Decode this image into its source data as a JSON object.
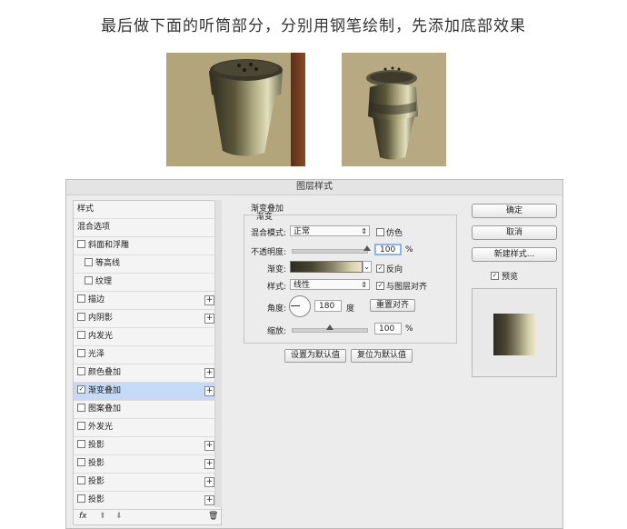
{
  "heading": "最后做下面的听筒部分，分别用钢笔绘制，先添加底部效果",
  "dialog": {
    "title": "图层样式",
    "left_panel": {
      "items": [
        {
          "label": "样式",
          "type": "header"
        },
        {
          "label": "混合选项",
          "type": "header"
        },
        {
          "label": "斜面和浮雕",
          "type": "check",
          "checked": false
        },
        {
          "label": "等高线",
          "type": "check-sub",
          "checked": false
        },
        {
          "label": "纹理",
          "type": "check-sub",
          "checked": false
        },
        {
          "label": "描边",
          "type": "check",
          "checked": false,
          "plus": true
        },
        {
          "label": "内阴影",
          "type": "check",
          "checked": false,
          "plus": true
        },
        {
          "label": "内发光",
          "type": "check",
          "checked": false
        },
        {
          "label": "光泽",
          "type": "check",
          "checked": false
        },
        {
          "label": "颜色叠加",
          "type": "check",
          "checked": false,
          "plus": true
        },
        {
          "label": "渐变叠加",
          "type": "check",
          "checked": true,
          "selected": true,
          "plus": true
        },
        {
          "label": "图案叠加",
          "type": "check",
          "checked": false
        },
        {
          "label": "外发光",
          "type": "check",
          "checked": false
        },
        {
          "label": "投影",
          "type": "check",
          "checked": false,
          "plus": true
        },
        {
          "label": "投影",
          "type": "check",
          "checked": false,
          "plus": true
        },
        {
          "label": "投影",
          "type": "check",
          "checked": false,
          "plus": true
        },
        {
          "label": "投影",
          "type": "check",
          "checked": false,
          "plus": true
        }
      ],
      "footer": {
        "fx": "fx",
        "up": "⬆",
        "down": "⬇",
        "trash": "🗑"
      }
    },
    "gradient_overlay": {
      "group_title": "渐变叠加",
      "group_sub": "渐变",
      "blend_mode_label": "混合模式:",
      "blend_mode_value": "正常",
      "dither_label": "仿色",
      "dither_checked": false,
      "opacity_label": "不透明度:",
      "opacity_value": "100",
      "opacity_unit": "%",
      "opacity_fraction": 1.0,
      "gradient_label": "渐变:",
      "reverse_label": "反向",
      "reverse_checked": true,
      "style_label": "样式:",
      "style_value": "线性",
      "align_label": "与图层对齐",
      "align_checked": true,
      "angle_label": "角度:",
      "angle_value": "180",
      "angle_unit": "度",
      "reset_align_label": "重置对齐",
      "scale_label": "缩放:",
      "scale_value": "100",
      "scale_unit": "%",
      "scale_fraction": 0.5,
      "make_default_label": "设置为默认值",
      "reset_default_label": "复位为默认值"
    },
    "right_panel": {
      "ok_label": "确定",
      "cancel_label": "取消",
      "new_style_label": "新建样式...",
      "preview_label": "预览",
      "preview_checked": true
    }
  }
}
